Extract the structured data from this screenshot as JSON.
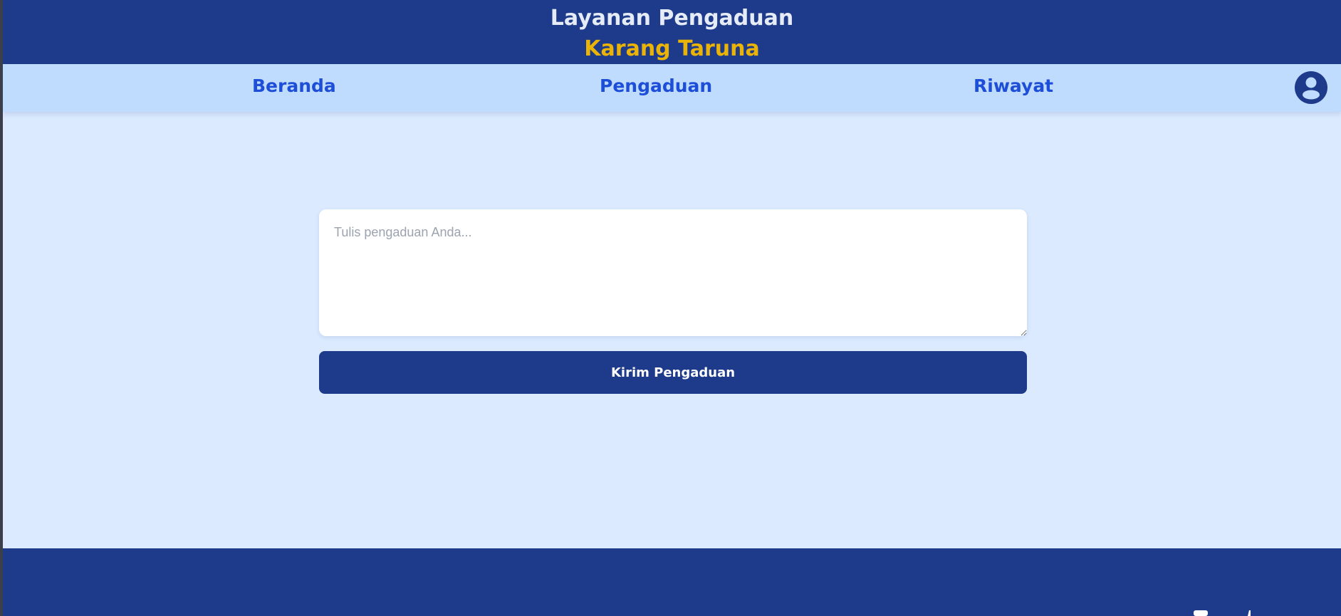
{
  "header": {
    "title": "Layanan Pengaduan",
    "subtitle": "Karang Taruna"
  },
  "nav": {
    "items": [
      {
        "label": "Beranda"
      },
      {
        "label": "Pengaduan"
      },
      {
        "label": "Riwayat"
      }
    ],
    "profile_icon": "user-circle-icon"
  },
  "form": {
    "complaint_placeholder": "Tulis pengaduan Anda...",
    "complaint_value": "",
    "submit_label": "Kirim Pengaduan"
  },
  "footer": {
    "icons": [
      "social-icon",
      "social-icon"
    ]
  },
  "colors": {
    "header_bg": "#1e3a8a",
    "subtitle": "#eab308",
    "nav_bg": "#bfdbfe",
    "nav_text": "#1d4ed8",
    "page_bg": "#dbeafe",
    "button_bg": "#1e3a8a"
  }
}
